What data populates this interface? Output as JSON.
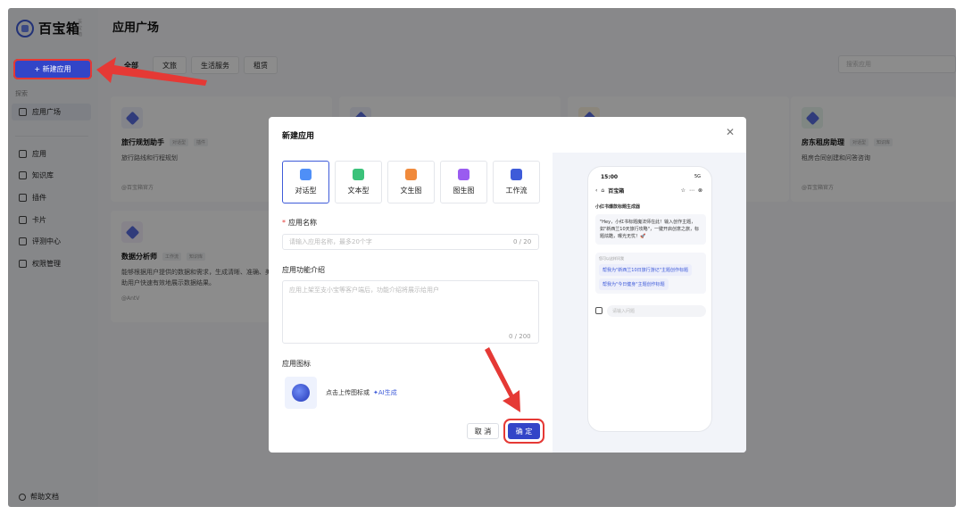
{
  "brand": {
    "name": "百宝箱",
    "tag": "百宝箱"
  },
  "sidebar": {
    "new_app_label": "+ 新建应用",
    "section_label": "探索",
    "items": [
      {
        "label": "应用广场",
        "icon": "compass-icon",
        "active": true
      },
      {
        "label": "应用",
        "icon": "cube-icon"
      },
      {
        "label": "知识库",
        "icon": "folder-icon"
      },
      {
        "label": "插件",
        "icon": "plugin-icon"
      },
      {
        "label": "卡片",
        "icon": "card-icon"
      },
      {
        "label": "评测中心",
        "icon": "chart-icon"
      },
      {
        "label": "权限管理",
        "icon": "lock-icon"
      }
    ],
    "help_label": "帮助文档"
  },
  "main": {
    "title": "应用广场",
    "tabs": [
      "全部",
      "文旅",
      "生活服务",
      "租赁"
    ],
    "search_placeholder": "搜索应用",
    "cards": [
      {
        "name": "旅行规划助手",
        "tag1": "对话型",
        "tag2": "插件",
        "desc": "旅行路线和行程规划",
        "author": "@百宝箱官方"
      },
      {
        "name": "房东租房助理",
        "tag1": "对话型",
        "tag2": "知识库",
        "desc": "租房合同创建和问答咨询",
        "author": "@百宝箱官方"
      },
      {
        "name": "数据分析师",
        "tag1": "工作流",
        "tag2": "知识库",
        "desc": "能够根据用户提供的数据和需求，生成清晰、准确、美观的各类图表。帮助用户快速有效地展示数据结果。",
        "author": "@AntV"
      }
    ]
  },
  "modal": {
    "title": "新建应用",
    "types": [
      {
        "label": "对话型",
        "color": "#4f8ff7",
        "selected": true
      },
      {
        "label": "文本型",
        "color": "#3bc27a"
      },
      {
        "label": "文生图",
        "color": "#f08a3c"
      },
      {
        "label": "图生图",
        "color": "#9a5cf0"
      },
      {
        "label": "工作流",
        "color": "#3e5bd9"
      }
    ],
    "name_label": "应用名称",
    "name_placeholder": "请输入应用名称，最多20个字",
    "name_counter": "0 / 20",
    "intro_label": "应用功能介绍",
    "intro_placeholder": "应用上架至支小宝等客户端后，功能介绍将展示给用户",
    "intro_counter": "0 / 200",
    "icon_label": "应用图标",
    "upload_hint": "点击上传图标或",
    "ai_label": "✦AI生成",
    "cancel_label": "取 消",
    "ok_label": "确 定"
  },
  "preview": {
    "time": "15:00",
    "signal": "5G",
    "app_name": "百宝箱",
    "bot_name": "小红书爆款标题生成器",
    "greeting": "\"Hey，小红书标题魔法师在此！输入创作主题，如\"新西兰10天旅行攻略\"，一键开启创意之旅，标题炫酷，曝光无忧！🚀",
    "suggest_title": "您可以这样问我",
    "suggestions": [
      "帮我为\"新西兰10日旅行游记\"主题创作标题",
      "帮我为\"今日健身\"主题创作标题"
    ],
    "input_placeholder": "请输入问题"
  },
  "colors": {
    "primary": "#3245c8",
    "highlight": "#e53935"
  }
}
